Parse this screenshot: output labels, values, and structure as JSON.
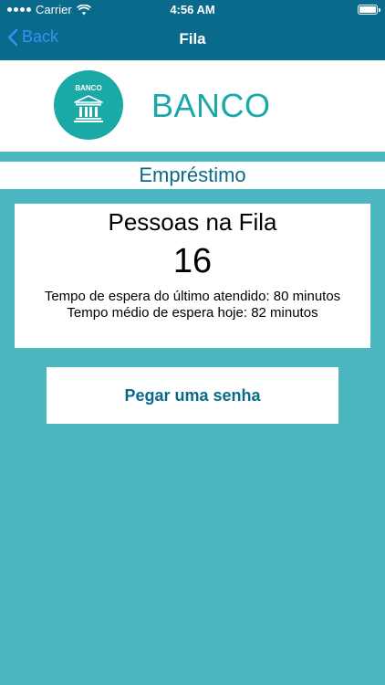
{
  "status_bar": {
    "carrier": "Carrier",
    "time": "4:56 AM",
    "icons": [
      "signal-icon",
      "wifi-icon",
      "battery-icon"
    ]
  },
  "nav": {
    "back_label": "Back",
    "title": "Fila"
  },
  "logo": {
    "circle_text": "BANCO",
    "wordmark": "BANCO",
    "icon": "bank-building-icon"
  },
  "section": {
    "title": "Empréstimo"
  },
  "queue": {
    "heading": "Pessoas na Fila",
    "count": "16",
    "last_wait": "Tempo de espera do último atendido: 80 minutos",
    "average_wait": "Tempo médio de espera hoje: 82 minutos"
  },
  "action": {
    "label": "Pegar uma senha"
  },
  "colors": {
    "background": "#4cb7c0",
    "nav_bar": "#0a6a8c",
    "back_link": "#3b8ff5",
    "logo_teal": "#1aa9a7",
    "accent_text": "#0a6a8c"
  }
}
